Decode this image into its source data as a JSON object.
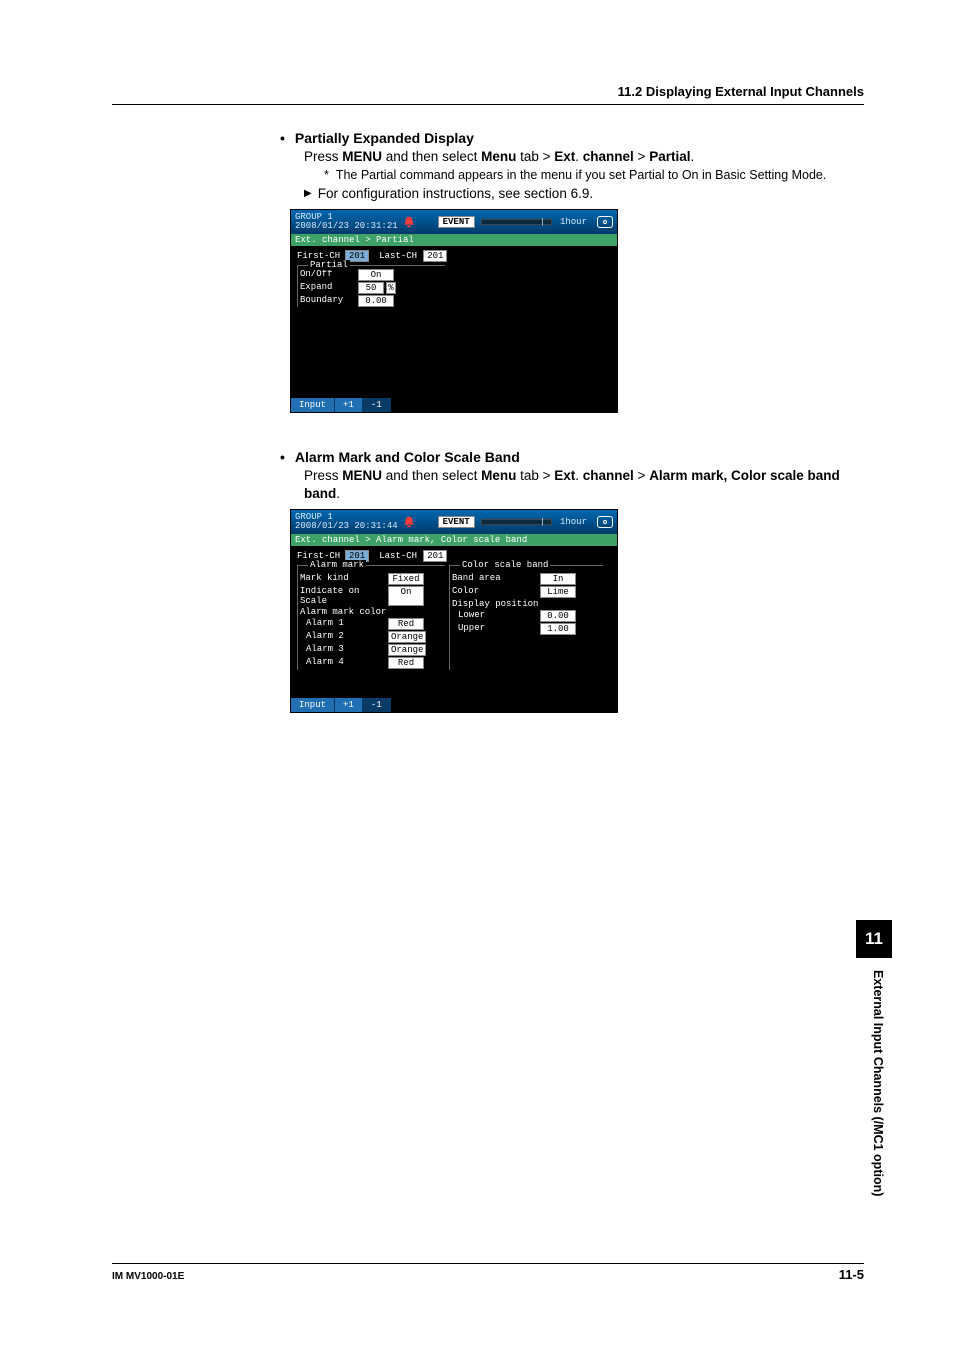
{
  "header": {
    "section_title": "11.2  Displaying External Input Channels"
  },
  "sec1": {
    "title": "Partially Expanded Display",
    "intro_prefix": "Press ",
    "menu_b": "MENU",
    "intro_mid": " and then select ",
    "menu_b2": "Menu",
    "intro_tab": " tab > ",
    "ext_b": "Ext",
    "dot": ". ",
    "channel_b": "channel",
    "gt": " > ",
    "partial_b": "Partial",
    "period": ".",
    "star": "*",
    "star_text": "The Partial command appears in the menu if you set Partial to On in Basic Setting Mode.",
    "tri_text": "For configuration instructions, see section 6.9."
  },
  "ss1": {
    "group": "GROUP 1",
    "time": "2008/01/23 20:31:21",
    "event": "EVENT",
    "onehour": "1hour",
    "breadcrumb": "Ext. channel > Partial",
    "first_ch_l": "First-CH",
    "first_ch_v": "201",
    "last_ch_l": "Last-CH",
    "last_ch_v": "201",
    "partial_legend": "Partial",
    "onoff_l": "On/Off",
    "onoff_v": "On",
    "expand_l": "Expand",
    "expand_v": "50",
    "expand_pct": "%",
    "boundary_l": "Boundary",
    "boundary_v": "0.00",
    "btn_input": "Input",
    "btn_p1": "+1",
    "btn_m1": "-1"
  },
  "sec2": {
    "title": "Alarm Mark and Color Scale Band",
    "intro_prefix": "Press ",
    "menu_b": "MENU",
    "intro_mid": " and then select ",
    "menu_b2": "Menu",
    "intro_tab": " tab > ",
    "ext_b": "Ext",
    "dot": ". ",
    "channel_b": "channel",
    "gt": " > ",
    "target_b": "Alarm mark, Color scale band",
    "period": "."
  },
  "ss2": {
    "group": "GROUP 1",
    "time": "2008/01/23 20:31:44",
    "event": "EVENT",
    "onehour": "1hour",
    "breadcrumb": "Ext. channel > Alarm mark, Color scale band",
    "first_ch_l": "First-CH",
    "first_ch_v": "201",
    "last_ch_l": "Last-CH",
    "last_ch_v": "201",
    "am_legend": "Alarm mark",
    "markkind_l": "Mark kind",
    "markkind_v": "Fixed",
    "ios_l": "Indicate on Scale",
    "ios_v": "On",
    "amcolor_l": "Alarm mark color",
    "a1_l": "Alarm 1",
    "a1_v": "Red",
    "a2_l": "Alarm 2",
    "a2_v": "Orange",
    "a3_l": "Alarm 3",
    "a3_v": "Orange",
    "a4_l": "Alarm 4",
    "a4_v": "Red",
    "csb_legend": "Color scale band",
    "ba_l": "Band area",
    "ba_v": "In",
    "color_l": "Color",
    "color_v": "Lime",
    "dp_l": "Display position",
    "lower_l": "Lower",
    "lower_v": "0.00",
    "upper_l": "Upper",
    "upper_v": "1.00",
    "btn_input": "Input",
    "btn_p1": "+1",
    "btn_m1": "-1"
  },
  "side": {
    "chapter": "11",
    "text": "External Input Channels (/MC1 option)"
  },
  "footer": {
    "left": "IM MV1000-01E",
    "right": "11-5"
  }
}
